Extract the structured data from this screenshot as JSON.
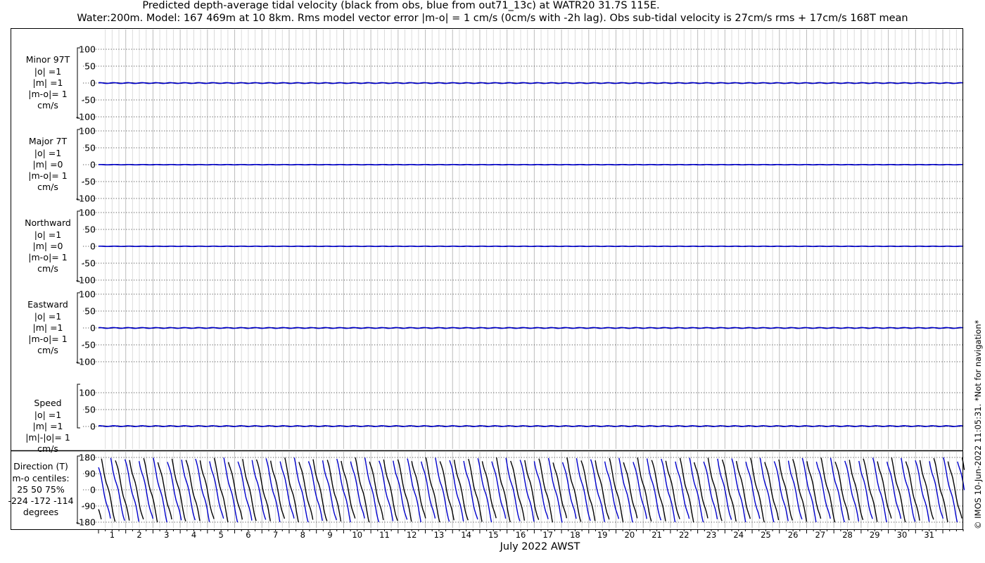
{
  "title_line1": "Predicted depth-average tidal velocity (black from obs, blue from out71_13c) at WATR20 31.7S 115E.",
  "title_line2": "Water:200m. Model: 167 469m at 10 8km. Rms model vector error |m-o| = 1 cm/s (0cm/s with -2h lag). Obs sub-tidal velocity is 27cm/s rms + 17cm/s 168T mean",
  "copyright": "© IMOS 10-Jun-2022 11:05:31. *Not for navigation*",
  "chart_data": {
    "type": "line",
    "xlabel": "July 2022 AWST",
    "x_ticks": [
      "1",
      "2",
      "3",
      "4",
      "5",
      "6",
      "7",
      "8",
      "9",
      "10",
      "11",
      "12",
      "13",
      "14",
      "15",
      "16",
      "17",
      "18",
      "19",
      "20",
      "21",
      "22",
      "23",
      "24",
      "25",
      "26",
      "27",
      "28",
      "29",
      "30",
      "31"
    ],
    "x_range_days": [
      0,
      31.8
    ],
    "grid": true,
    "series_colors": {
      "obs": "#000000",
      "model": "#0000cd"
    },
    "panels": [
      {
        "label": [
          "Minor 97T",
          "|o| =1",
          "|m| =1",
          "|m-o|= 1",
          "cm/s"
        ],
        "y_ticks": [
          "100",
          "50",
          "0",
          "-50",
          "-100"
        ],
        "ylim": [
          -100,
          100
        ],
        "obs_amplitude": 1,
        "model_amplitude": 1
      },
      {
        "label": [
          "Major 7T",
          "|o| =1",
          "|m| =0",
          "|m-o|= 1",
          "cm/s"
        ],
        "y_ticks": [
          "100",
          "50",
          "0",
          "-50",
          "-100"
        ],
        "ylim": [
          -100,
          100
        ],
        "obs_amplitude": 1,
        "model_amplitude": 0
      },
      {
        "label": [
          "Northward",
          "|o| =1",
          "|m| =0",
          "|m-o|= 1",
          "cm/s"
        ],
        "y_ticks": [
          "100",
          "50",
          "0",
          "-50",
          "-100"
        ],
        "ylim": [
          -100,
          100
        ],
        "obs_amplitude": 1,
        "model_amplitude": 0
      },
      {
        "label": [
          "Eastward",
          "|o| =1",
          "|m| =1",
          "|m-o|= 1",
          "cm/s"
        ],
        "y_ticks": [
          "100",
          "50",
          "0",
          "-50",
          "-100"
        ],
        "ylim": [
          -100,
          100
        ],
        "obs_amplitude": 1,
        "model_amplitude": 1
      },
      {
        "label": [
          "Speed",
          "|o| =1",
          "|m| =1",
          "|m|-|o|= 1",
          "cm/s"
        ],
        "y_ticks": [
          "100",
          "50",
          "0"
        ],
        "ylim": [
          0,
          100
        ],
        "obs_amplitude": 1,
        "model_amplitude": 1
      },
      {
        "label": [
          "Direction (T)",
          "m-o centiles:",
          "25  50  75%",
          "-224 -172 -114",
          "degrees"
        ],
        "y_ticks": [
          "180",
          "90",
          "0",
          "-90",
          "-180"
        ],
        "ylim": [
          -180,
          180
        ],
        "obs_cycles_per_day": 1.93,
        "model_cycles_per_day": 1.93,
        "model_phase_lag_days": 0.35
      }
    ]
  }
}
